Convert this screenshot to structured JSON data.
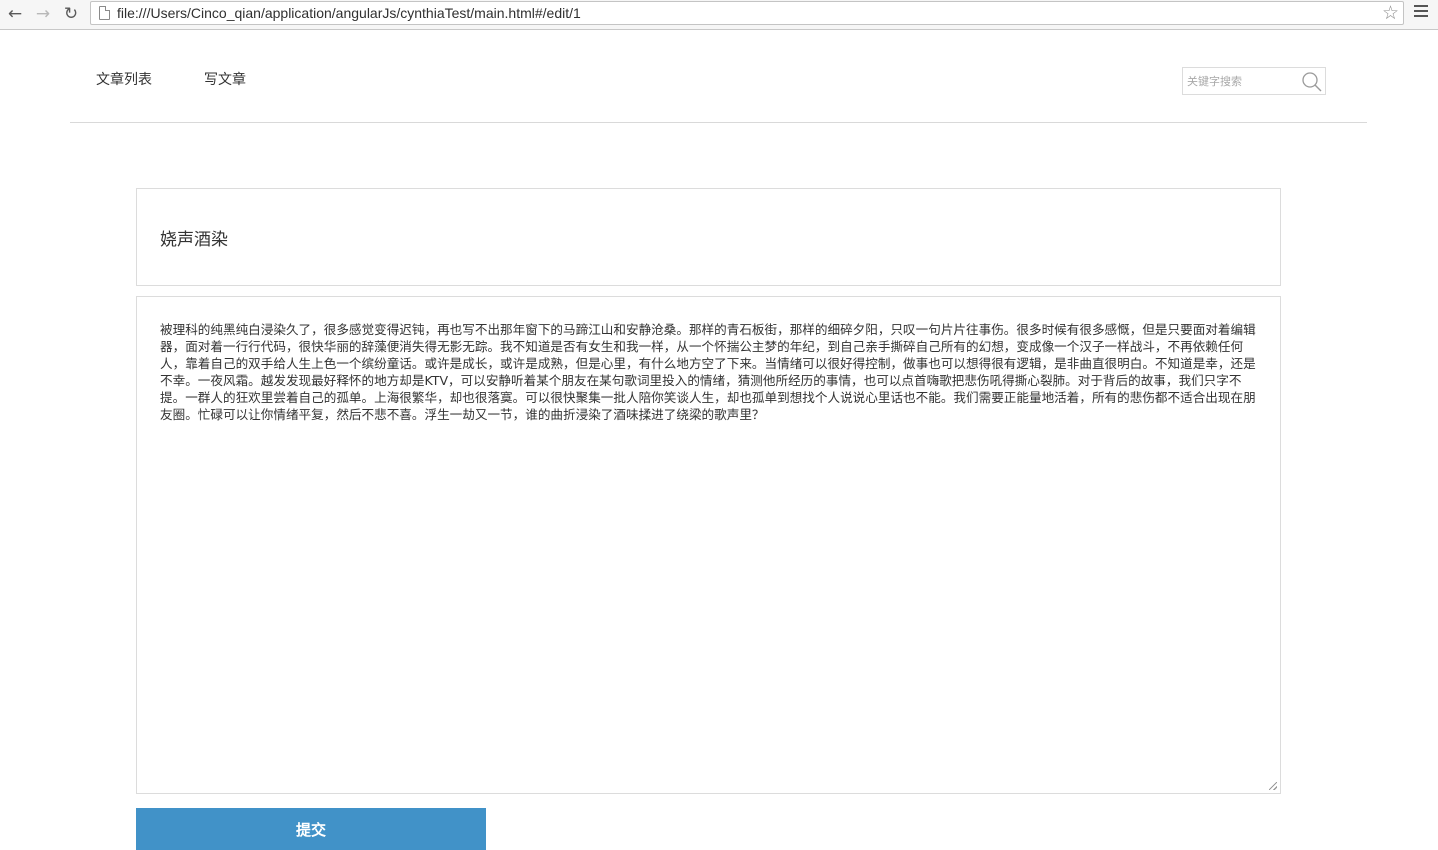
{
  "browser": {
    "back_glyph": "←",
    "forward_glyph": "→",
    "reload_glyph": "↻",
    "url": "file:///Users/Cinco_qian/application/angularJs/cynthiaTest/main.html#/edit/1",
    "star_glyph": "☆",
    "icons": [
      "back-icon",
      "forward-icon",
      "reload-icon",
      "file-icon",
      "bookmark-star-icon",
      "menu-icon"
    ]
  },
  "header": {
    "nav": [
      {
        "label": "文章列表"
      },
      {
        "label": "写文章"
      }
    ],
    "search": {
      "placeholder": "关键字搜索",
      "value": "",
      "icon": "search-icon"
    }
  },
  "form": {
    "title_value": "娆声酒染",
    "content_value": "被理科的纯黑纯白浸染久了，很多感觉变得迟钝，再也写不出那年窗下的马蹄江山和安静沧桑。那样的青石板街，那样的细碎夕阳，只叹一句片片往事伤。很多时候有很多感慨，但是只要面对着编辑器，面对着一行行代码，很快华丽的辞藻便消失得无影无踪。我不知道是否有女生和我一样，从一个怀揣公主梦的年纪，到自己亲手撕碎自己所有的幻想，变成像一个汉子一样战斗，不再依赖任何人，靠着自己的双手给人生上色一个缤纷童话。或许是成长，或许是成熟，但是心里，有什么地方空了下来。当情绪可以很好得控制，做事也可以想得很有逻辑，是非曲直很明白。不知道是幸，还是不幸。一夜风霜。越发发现最好释怀的地方却是KTV，可以安静听着某个朋友在某句歌词里投入的情绪，猜测他所经历的事情，也可以点首嗨歌把悲伤吼得撕心裂肺。对于背后的故事，我们只字不提。一群人的狂欢里尝着自己的孤单。上海很繁华，却也很落寞。可以很快聚集一批人陪你笑谈人生，却也孤单到想找个人说说心里话也不能。我们需要正能量地活着，所有的悲伤都不适合出现在朋友圈。忙碌可以让你情绪平复，然后不悲不喜。浮生一劫又一节，谁的曲折浸染了酒味揉进了绕梁的歌声里？",
    "submit_label": "提交"
  },
  "colors": {
    "accent": "#4192c8",
    "border": "#dcdcdc",
    "text": "#333333"
  }
}
